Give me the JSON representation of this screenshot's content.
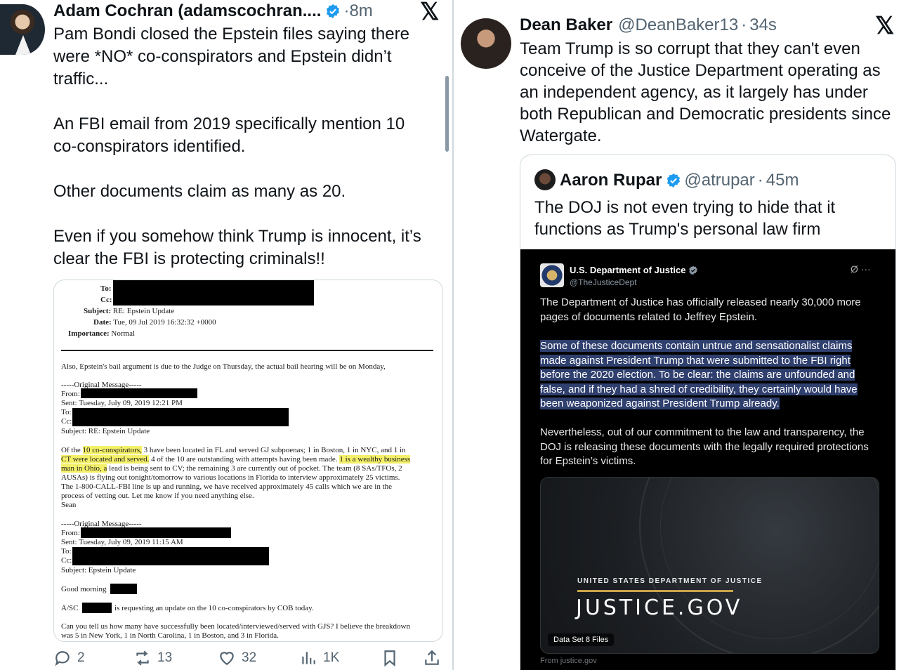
{
  "left_tweet": {
    "name": "Adam Cochran (adamscochran....",
    "dot": "·",
    "time": "8m",
    "paragraphs": [
      "Pam Bondi closed the Epstein files saying there\nwere *NO* co-conspirators and Epstein didn’t\ntraffic...",
      "An FBI email from 2019 specifically mention 10\nco-conspirators identified.",
      "Other documents claim as many as 20.",
      "Even if you somehow think Trump is innocent, it’s\nclear the FBI is protecting criminals!!"
    ],
    "actions": {
      "replies": "2",
      "reposts": "13",
      "likes": "32",
      "views": "1K"
    }
  },
  "document": {
    "to_label": "To:",
    "cc_label": "Cc:",
    "subject_label": "Subject:",
    "subject": "RE: Epstein Update",
    "date_label": "Date:",
    "date": "Tue, 09 Jul 2019 16:32:32 +0000",
    "importance_label": "Importance:",
    "importance": "Normal",
    "line_bail": "Also, Epstein's bail argument is due to the Judge on Thursday, the actual bail hearing will be on Monday,",
    "orig1_header": "-----Original Message-----",
    "orig1_from": "From:",
    "orig1_sent": "Sent: Tuesday, July 09, 2019 12:21 PM",
    "orig1_to": "To:",
    "orig1_cc": "Cc:",
    "orig1_subject": "Subject: RE: Epstein Update",
    "body_1a": "Of the ",
    "body_1b": "10 co-conspirators,",
    "body_1c": " 3 have been located in FL and served GJ subpoenas; 1 in Boston, 1 in NYC, and 1 in",
    "body_2a": "CT were located and served.",
    "body_2b": " 4 of the 10 are outstanding with attempts having been made. ",
    "body_2c": "1 is a wealthy business",
    "body_3a": "man in Ohio, a",
    "body_3b": " lead is being sent to CV; the remaining 3 are currently out of pocket. The team (8 SAs/TFOs, 2",
    "body_4": "AUSAs) is flying out tonight/tomorrow to various locations in Florida to interview approximately 25 victims.",
    "body_5": "The 1-800-CALL-FBI line is up and running, we have received approximately 45 calls which we are in the",
    "body_6": "process of vetting out. Let me know if you need anything else.",
    "signoff": "Sean",
    "orig2_header": "-----Original Message-----",
    "orig2_from": "From:",
    "orig2_sent": "Sent: Tuesday, July 09, 2019 11:15 AM",
    "orig2_to": "To:",
    "orig2_cc": "Cc:",
    "orig2_subject": "Subject: Epstein Update",
    "good_morning": "Good morning",
    "asc_a": "A/SC",
    "asc_b": "is requesting an update on the 10 co-conspirators by COB today.",
    "last_1": "Can you tell us how many have successfully been located/interviewed/served with GJS? I believe the breakdown",
    "last_2": "was 5 in New York, 1 in North Carolina, 1 in Boston, and 3 in Florida."
  },
  "right_tweet": {
    "name": "Dean Baker",
    "handle": "@DeanBaker13",
    "dot": "·",
    "time": "34s",
    "text": "Team Trump is so corrupt that they can't even\nconceive of the Justice Department operating as\nan independent agency, as it largely has under\nboth Republican and Democratic presidents since\nWatergate."
  },
  "quoted_tweet": {
    "name": "Aaron Rupar",
    "handle": "@atrupar",
    "dot": "·",
    "time": "45m",
    "text": "The DOJ is not even trying to hide that it\nfunctions as Trump's personal law firm"
  },
  "doj_post": {
    "name": "U.S. Department of Justice",
    "handle": "@TheJusticeDept",
    "icons": "Ø ···",
    "p1": "The Department of Justice has officially released nearly 30,000 more\npages of documents related to Jeffrey Epstein.",
    "p2_lines": [
      "Some of these documents contain untrue and sensationalist claims",
      "made against President Trump that were submitted to the FBI right",
      "before the 2020 election. To be clear: the claims are unfounded and",
      "false, and if they had a shred of credibility, they certainly would have",
      "been weaponized against President Trump already."
    ],
    "p3": "Nevertheless, out of our commitment to the law and transparency, the\nDOJ is releasing these documents with the legally required protections\nfor Epstein’s victims.",
    "card_subtitle": "UNITED STATES DEPARTMENT OF JUSTICE",
    "card_title": "JUSTICE.GOV",
    "card_badge": "Data Set 8 Files",
    "from": "From justice.gov"
  },
  "x_logo": "𝕏",
  "colors": {
    "verified": "#1d9bf0",
    "highlight": "#f4f06a",
    "selection": "#2f3f6e",
    "gold_bar": "#c9a24a"
  }
}
